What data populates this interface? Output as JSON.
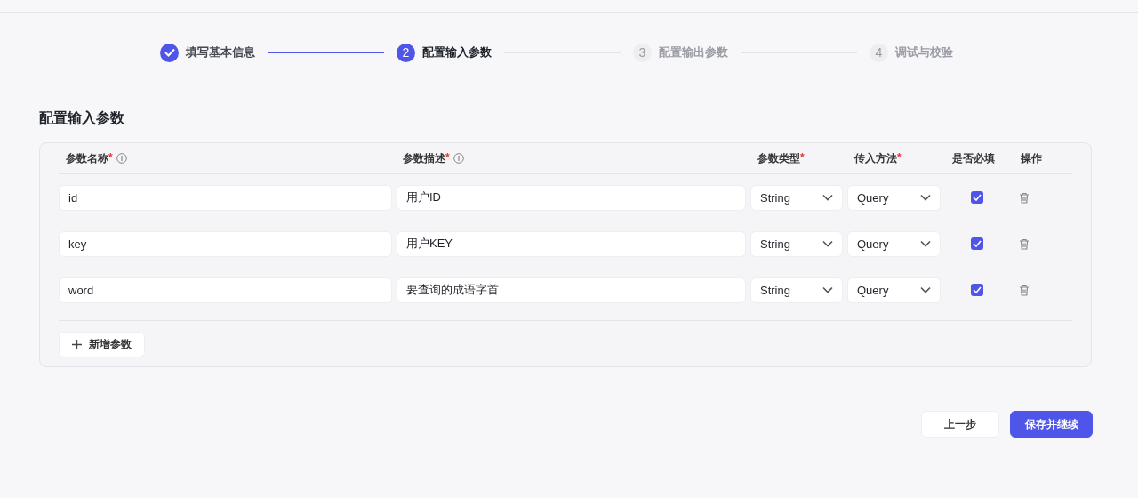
{
  "steps": [
    {
      "label": "填写基本信息",
      "completed": true,
      "selected": false
    },
    {
      "number": "2",
      "label": "配置输入参数",
      "completed": false,
      "selected": true
    },
    {
      "number": "3",
      "label": "配置输出参数",
      "completed": false,
      "selected": false
    },
    {
      "number": "4",
      "label": "调试与校验",
      "completed": false,
      "selected": false
    }
  ],
  "section_title": "配置输入参数",
  "table": {
    "columns": [
      {
        "label": "参数名称",
        "required_mark": "*",
        "info": true
      },
      {
        "label": "参数描述",
        "required_mark": "*",
        "info": true
      },
      {
        "label": "参数类型",
        "required_mark": "*",
        "info": false
      },
      {
        "label": "传入方法",
        "required_mark": "*",
        "info": false
      },
      {
        "label": "是否必填",
        "info": false
      },
      {
        "label": "操作",
        "info": false
      }
    ],
    "rows": [
      {
        "name": "id",
        "description": "用户ID",
        "type": "String",
        "method": "Query",
        "checked": true
      },
      {
        "name": "key",
        "description": "用户KEY",
        "type": "String",
        "method": "Query",
        "checked": true
      },
      {
        "name": "word",
        "description": "要查询的成语字首",
        "type": "String",
        "method": "Query",
        "checked": true
      }
    ]
  },
  "add_button": "新增参数",
  "buttons": [
    {
      "label": "上一步",
      "kind": "secondary"
    },
    {
      "label": "保存并继续",
      "kind": "primary"
    }
  ]
}
